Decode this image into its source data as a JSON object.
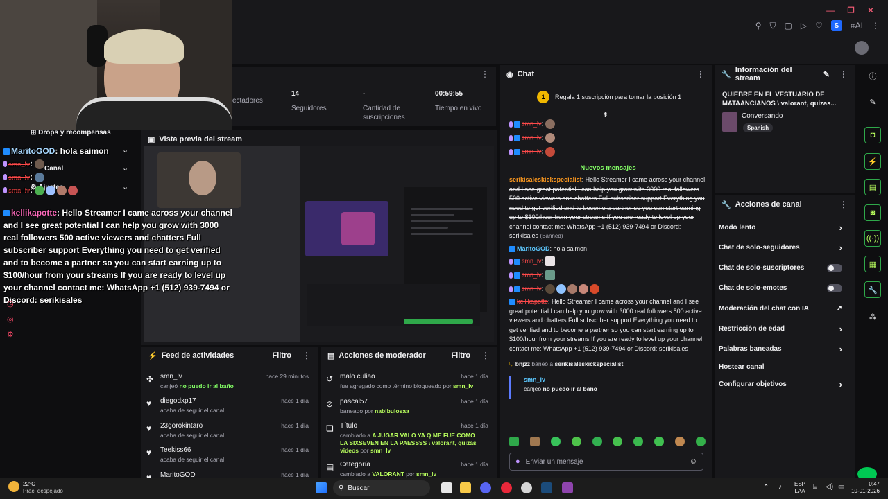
{
  "window": {
    "minimize": "—",
    "restore": "❐",
    "close": "✕"
  },
  "toolbar": {
    "icons": [
      "pin-icon",
      "shield-icon",
      "square-icon",
      "play-icon",
      "heart-icon"
    ],
    "profile_letter": "S",
    "ai_label": "AI"
  },
  "stats": [
    {
      "value": "",
      "label": "ectadores"
    },
    {
      "value": "14",
      "label": "Seguidores"
    },
    {
      "value": "-",
      "label": "Cantidad de suscripciones"
    },
    {
      "value": "00:59:55",
      "label": "Tiempo en vivo"
    }
  ],
  "preview": {
    "title": "Vista previa del stream"
  },
  "overlay": {
    "menu": [
      {
        "label": "Drops y recompensas"
      },
      {
        "label": "Canal"
      },
      {
        "label": "Ajustes"
      }
    ],
    "chat": [
      {
        "user": "MaritoGOD",
        "text": ": hola saimon"
      },
      {
        "user": "smn_lv",
        "text": ":"
      },
      {
        "user": "smn_lv",
        "text": ":"
      },
      {
        "user": "smn_lv",
        "text": ":"
      }
    ],
    "spam_user": "kellikapotte",
    "spam_text": ": Hello Streamer I came across your channel and I see great potential I can help you grow with 3000 real followers 500 active viewers and chatters Full subscriber support Everything you need to get verified and to become a partner so you can start earning up to $100/hour from your streams If you are ready to level up your channel contact me: WhatsApp +1 (512) 939-7494 or Discord: serikisales"
  },
  "activity_feed": {
    "title": "Feed de actividades",
    "filter": "Filtro",
    "items": [
      {
        "name": "smn_lv",
        "time": "hace 29 minutos",
        "action": "canjeó",
        "highlight": "no puedo ir al baño",
        "icon": "points-icon"
      },
      {
        "name": "diegodxp17",
        "time": "hace 1 día",
        "action": "acaba de seguir el canal",
        "highlight": "",
        "icon": "heart-icon"
      },
      {
        "name": "23gorokintaro",
        "time": "hace 1 día",
        "action": "acaba de seguir el canal",
        "highlight": "",
        "icon": "heart-icon"
      },
      {
        "name": "Teekiss66",
        "time": "hace 1 día",
        "action": "acaba de seguir el canal",
        "highlight": "",
        "icon": "heart-icon"
      },
      {
        "name": "MaritoGOD",
        "time": "hace 1 día",
        "action": "",
        "highlight": "",
        "icon": "heart-icon"
      }
    ]
  },
  "mod_actions": {
    "title": "Acciones de moderador",
    "filter": "Filtro",
    "items": [
      {
        "name": "malo culiao",
        "time": "hace 1 día",
        "pre": "fue agregado como término bloqueado por",
        "by": "smn_lv"
      },
      {
        "name": "pascal57",
        "time": "hace 1 día",
        "pre": "baneado por",
        "by": "nabibulosaa"
      },
      {
        "name": "Título",
        "time": "hace 1 día",
        "pre": "cambiado a",
        "value": "A JUGAR VALO YA Q ME FUE COMO LA SIXSEVEN EN LA PAESSSS \\ valorant, quizas videos",
        "by_pre": "por",
        "by": "smn_lv"
      },
      {
        "name": "Categoría",
        "time": "hace 1 día",
        "pre": "cambiado a",
        "value": "VALORANT",
        "by_pre": "por",
        "by": "smn_lv"
      }
    ]
  },
  "chat": {
    "title": "Chat",
    "gift_text": "Regala 1 suscripción para tomar la posición 1",
    "gift_rank": "1",
    "new_messages": "Nuevos mensajes",
    "users": {
      "smn": "smn_lv",
      "marito": "MaritoGOD",
      "kelli": "kellikapotte",
      "serik": "serikisaleskickspecialist",
      "bnjzz": "bnjzz"
    },
    "banned_label": "(Banned)",
    "spam_text": "Hello Streamer I came across your channel and I see great potential I can help you grow with 3000 real followers 500 active viewers and chatters Full subscriber support Everything you need to get verified and to become a partner so you can start earning up to $100/hour from your streams If you are ready to level up your channel contact me: WhatsApp +1 (512) 939-7494 or Discord: serikisales",
    "marito_msg": "hola saimon",
    "ban_notice": "baneó a",
    "redeem_user": "smn_lv",
    "redeem_text": "canjeó",
    "redeem_highlight": "no puedo ir al baño",
    "input_placeholder": "Enviar un mensaje"
  },
  "stream_info": {
    "title": "Información del stream",
    "stream_title": "QUIEBRE EN EL VESTUARIO DE MATAANCIANOS \\ valorant, quizas...",
    "category": "Conversando",
    "language": "Spanish"
  },
  "channel_actions": {
    "title": "Acciones de canal",
    "items": [
      {
        "label": "Modo lento",
        "control": "chevron"
      },
      {
        "label": "Chat de solo-seguidores",
        "control": "chevron"
      },
      {
        "label": "Chat de solo-suscriptores",
        "control": "toggle"
      },
      {
        "label": "Chat de solo-emotes",
        "control": "toggle"
      },
      {
        "label": "Moderación del chat con IA",
        "control": "external"
      },
      {
        "label": "Restricción de edad",
        "control": "chevron"
      },
      {
        "label": "Palabras baneadas",
        "control": "chevron"
      },
      {
        "label": "Hostear canal",
        "control": "none"
      },
      {
        "label": "Configurar objetivos",
        "control": "chevron"
      }
    ]
  },
  "taskbar": {
    "weather_temp": "22°C",
    "weather_desc": "Prac. despejado",
    "search": "Buscar",
    "lang1": "ESP",
    "lang2": "LAA",
    "time": "0:47",
    "date": "10-01-2026"
  }
}
